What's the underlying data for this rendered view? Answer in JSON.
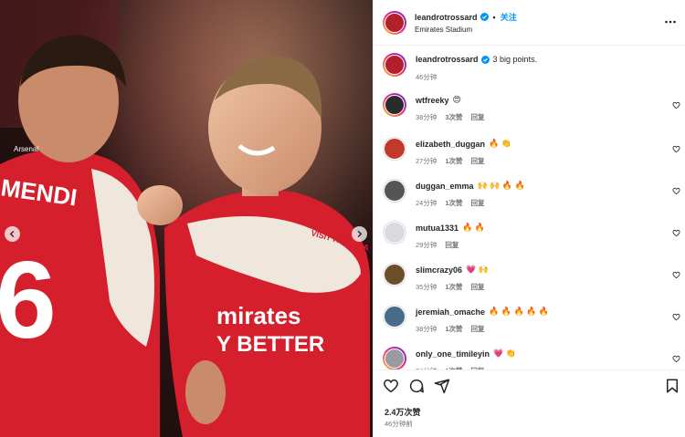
{
  "post": {
    "username": "leandrotrossard",
    "follow_label": "关注",
    "location": "Emirates Stadium",
    "caption_user": "leandrotrossard",
    "caption": "3 big points.",
    "caption_time": "46分钟",
    "likes": "2.4万次赞",
    "time_ago": "46分钟前",
    "photo_text": {
      "left_name": "MENDI",
      "left_number": "6",
      "left_club": "Arsenal",
      "sponsor_line1": "mirates",
      "sponsor_line2": "Y BETTER",
      "sleeve": "VISIT RWANDA"
    }
  },
  "comments": [
    {
      "user": "wtfreeky",
      "text": "😍",
      "time": "38分钟",
      "likes": "3次赞",
      "reply": "回复",
      "ring": true,
      "avatar_color": "#2b2b2b"
    },
    {
      "user": "elizabeth_duggan",
      "text": "🔥 👏",
      "time": "27分钟",
      "likes": "1次赞",
      "reply": "回复",
      "ring": false,
      "avatar_color": "#c0392b"
    },
    {
      "user": "duggan_emma",
      "text": "🙌 🙌 🔥 🔥",
      "time": "24分钟",
      "likes": "1次赞",
      "reply": "回复",
      "ring": false,
      "avatar_color": "#555555"
    },
    {
      "user": "mutua1331",
      "text": "🔥 🔥",
      "time": "29分钟",
      "likes": "",
      "reply": "回复",
      "ring": false,
      "avatar_color": "#d9d9e0"
    },
    {
      "user": "slimcrazy06",
      "text": "💗 🙌",
      "time": "35分钟",
      "likes": "1次赞",
      "reply": "回复",
      "ring": false,
      "avatar_color": "#6b4e2e"
    },
    {
      "user": "jeremiah_omache",
      "text": "🔥 🔥 🔥 🔥 🔥",
      "time": "38分钟",
      "likes": "1次赞",
      "reply": "回复",
      "ring": false,
      "avatar_color": "#4a6a8a"
    },
    {
      "user": "only_one_timileyin",
      "text": "💗 👏",
      "time": "34分钟",
      "likes": "1次赞",
      "reply": "回复",
      "ring": true,
      "avatar_color": "#9a9aa3"
    }
  ],
  "colors": {
    "accent": "#0095f6",
    "verified": "#0095f6",
    "arsenal_red": "#d51f2c"
  },
  "icons": [
    "heart-icon",
    "comment-icon",
    "share-icon",
    "bookmark-icon",
    "more-icon",
    "verified-icon",
    "chevron-left-icon",
    "chevron-right-icon"
  ]
}
